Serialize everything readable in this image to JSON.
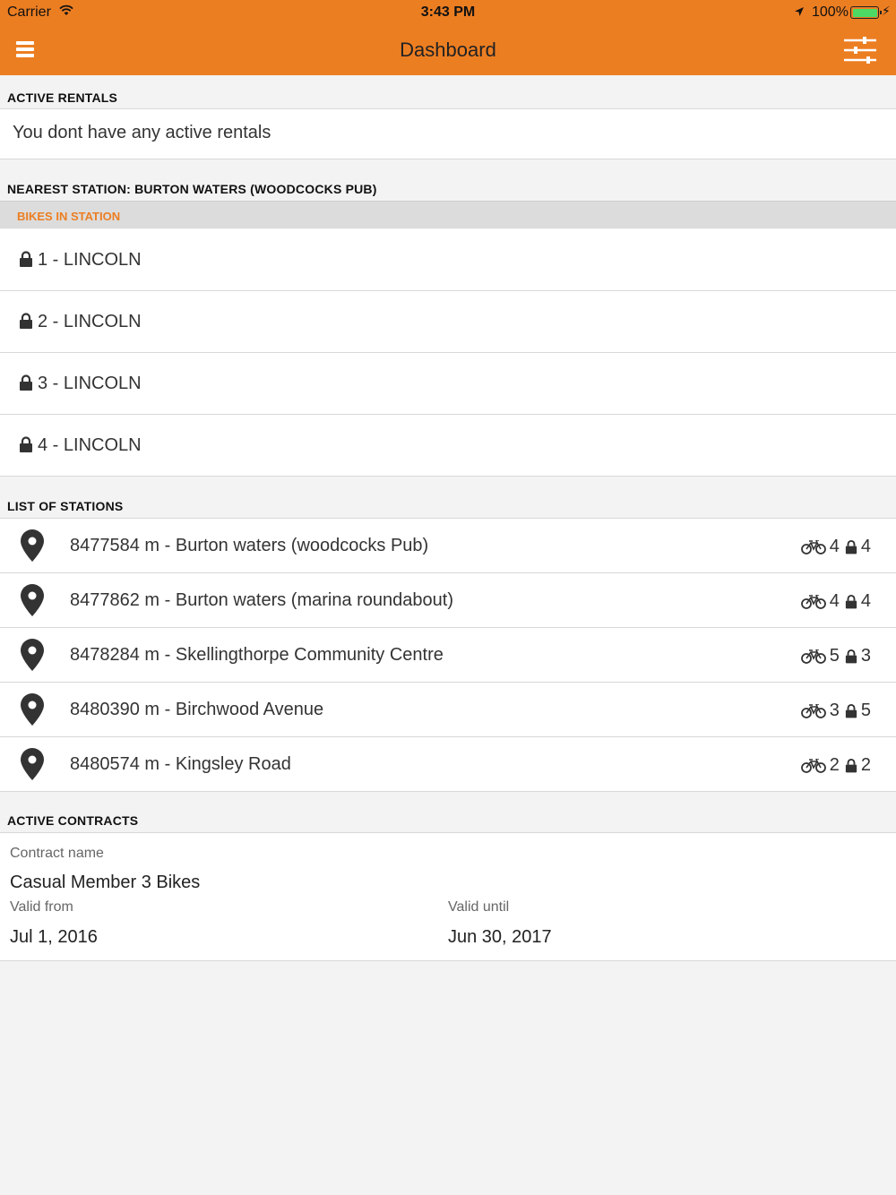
{
  "status_bar": {
    "carrier": "Carrier",
    "time": "3:43 PM",
    "battery": "100%"
  },
  "nav": {
    "title": "Dashboard"
  },
  "active_rentals": {
    "header": "ACTIVE RENTALS",
    "empty_text": "You dont have any active rentals"
  },
  "nearest_station": {
    "header": "NEAREST STATION: BURTON WATERS (WOODCOCKS PUB)",
    "subheader": "BIKES IN STATION",
    "bikes": [
      "1 - LINCOLN",
      "2 - LINCOLN",
      "3 - LINCOLN",
      "4 - LINCOLN"
    ]
  },
  "stations": {
    "header": "LIST OF STATIONS",
    "items": [
      {
        "name": "8477584 m - Burton waters (woodcocks Pub)",
        "bikes": "4",
        "docks": "4"
      },
      {
        "name": "8477862 m - Burton waters (marina roundabout)",
        "bikes": "4",
        "docks": "4"
      },
      {
        "name": "8478284 m - Skellingthorpe Community Centre",
        "bikes": "5",
        "docks": "3"
      },
      {
        "name": "8480390 m - Birchwood Avenue",
        "bikes": "3",
        "docks": "5"
      },
      {
        "name": "8480574 m - Kingsley Road",
        "bikes": "2",
        "docks": "2"
      }
    ]
  },
  "contracts": {
    "header": "ACTIVE CONTRACTS",
    "name_label": "Contract name",
    "name_value": "Casual Member 3 Bikes",
    "valid_from_label": "Valid from",
    "valid_from_value": "Jul 1, 2016",
    "valid_until_label": "Valid until",
    "valid_until_value": "Jun 30, 2017"
  },
  "colors": {
    "accent": "#ec7e22",
    "background": "#f3f3f3",
    "battery": "#4cd964"
  },
  "icons": [
    "wifi-icon",
    "location-arrow-icon",
    "battery-icon",
    "menu-icon",
    "filter-icon",
    "lock-icon",
    "map-pin-icon",
    "bicycle-icon"
  ]
}
